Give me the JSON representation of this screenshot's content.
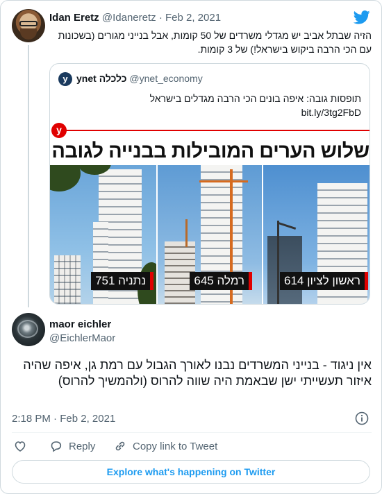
{
  "parent_tweet": {
    "author_name": "Idan Eretz",
    "author_handle": "@Idaneretz",
    "separator": "·",
    "date": "Feb 2, 2021",
    "text": "הזיה שבתל אביב יש מגדלי משרדים של 50 קומות, אבל בנייני מגורים (בשכונות עם הכי הרבה ביקוש בישראל!) של 3 קומות."
  },
  "quoted_tweet": {
    "author_name": "ynet כלכלה",
    "author_handle": "@ynet_economy",
    "text": "תופסות גובה: איפה בונים הכי הרבה מגדלים בישראל",
    "link": "bit.ly/3tg2FbD",
    "image": {
      "logo_letter": "y",
      "headline": "שלוש הערים המובילות בבנייה לגובה",
      "labels": [
        "נתניה 751",
        "רמלה 645",
        "ראשון לציון 614"
      ]
    }
  },
  "reply_tweet": {
    "author_name": "maor eichler",
    "author_handle": "@EichlerMaor",
    "text": "אין ניגוד - בנייני המשרדים נבנו לאורך הגבול עם רמת גן, איפה שהיה איזור תעשייתי ישן שבאמת היה שווה להרוס (ולהמשיך להרוס)",
    "time": "2:18 PM",
    "separator": "·",
    "date": "Feb 2, 2021"
  },
  "actions": {
    "like_icon": "heart-icon",
    "reply_label": "Reply",
    "copy_link_label": "Copy link to Tweet"
  },
  "explore_label": "Explore what's happening on Twitter",
  "colors": {
    "twitter_blue": "#1d9bf0",
    "ynet_red": "#e00000",
    "muted_text": "#536471",
    "border": "#cfd9de"
  }
}
